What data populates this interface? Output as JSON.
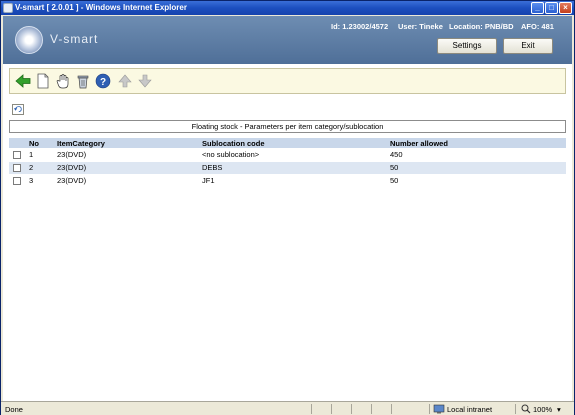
{
  "window": {
    "title": "V-smart [ 2.0.01 ] - Windows Internet Explorer"
  },
  "header": {
    "logo_text": "V-smart",
    "id_text": "Id: 1.23002/4572",
    "user_text": "User: Tineke",
    "location_text": "Location: PNB/BD",
    "afo_text": "AFO: 481",
    "settings_label": "Settings",
    "exit_label": "Exit"
  },
  "toolbar": {
    "icons": [
      "back-arrow-icon",
      "new-document-icon",
      "hand-select-icon",
      "trash-icon",
      "help-icon",
      "up-arrow-icon",
      "down-arrow-icon"
    ]
  },
  "table": {
    "caption": "Floating stock - Parameters per item category/sublocation",
    "columns": {
      "no": "No",
      "category": "ItemCategory",
      "sublocation": "Sublocation code",
      "allowed": "Number allowed"
    },
    "rows": [
      {
        "no": "1",
        "category": "23(DVD)",
        "sublocation": "<no sublocation>",
        "allowed": "450"
      },
      {
        "no": "2",
        "category": "23(DVD)",
        "sublocation": "DEBS",
        "allowed": "50"
      },
      {
        "no": "3",
        "category": "23(DVD)",
        "sublocation": "JF1",
        "allowed": "50"
      }
    ]
  },
  "statusbar": {
    "status": "Done",
    "zone": "Local intranet",
    "zoom": "100%"
  },
  "colors": {
    "banner": "#5f7fa8",
    "header_row": "#c9d7ea",
    "alt_row": "#dde6f2",
    "toolbar_bg": "#fbf9e2"
  }
}
